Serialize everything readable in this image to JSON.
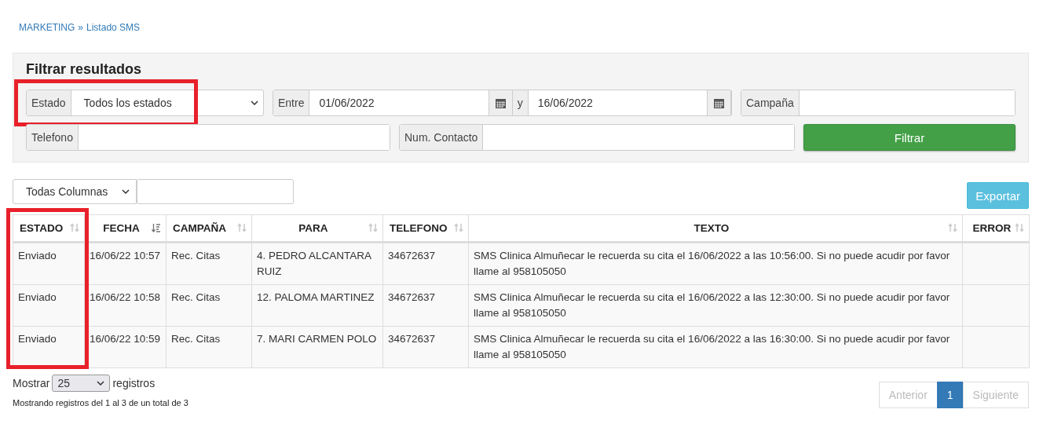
{
  "breadcrumb": {
    "items": [
      "MARKETING",
      "Listado SMS"
    ],
    "separator": "»"
  },
  "filters": {
    "title": "Filtrar resultados",
    "estado": {
      "label": "Estado",
      "value": "Todos los estados",
      "highlighted": true
    },
    "date_range": {
      "label": "Entre",
      "from": "01/06/2022",
      "joiner": "y",
      "to": "16/06/2022"
    },
    "campana": {
      "label": "Campaña"
    },
    "telefono": {
      "label": "Telefono"
    },
    "num_contacto": {
      "label": "Num. Contacto"
    },
    "button": "Filtrar"
  },
  "toolbar": {
    "column_select": "Todas Columnas",
    "export_button": "Exportar"
  },
  "table": {
    "columns": [
      {
        "label": "ESTADO",
        "sorted": false,
        "highlighted": true
      },
      {
        "label": "FECHA",
        "sorted": true,
        "highlighted": false
      },
      {
        "label": "CAMPAÑA",
        "sorted": false,
        "highlighted": false
      },
      {
        "label": "PARA",
        "sorted": false,
        "highlighted": false
      },
      {
        "label": "TELEFONO",
        "sorted": false,
        "highlighted": false
      },
      {
        "label": "TEXTO",
        "sorted": false,
        "highlighted": false
      },
      {
        "label": "ERROR",
        "sorted": false,
        "highlighted": false
      }
    ],
    "rows": [
      [
        "Enviado",
        "16/06/22 10:57",
        "Rec. Citas",
        "4. PEDRO ALCANTARA RUIZ",
        "34672637",
        "SMS Clinica Almuñecar le recuerda su cita el 16/06/2022 a las 10:56:00. Si no puede acudir por favor llame al 958105050"
      ],
      [
        "Enviado",
        "16/06/22 10:58",
        "Rec. Citas",
        "12. PALOMA MARTINEZ",
        "34672637",
        "SMS Clinica Almuñecar le recuerda su cita el 16/06/2022 a las 12:30:00. Si no puede acudir por favor llame al 958105050"
      ],
      [
        "Enviado",
        "16/06/22 10:59",
        "Rec. Citas",
        "7. MARI CARMEN POLO",
        "34672637",
        "SMS Clinica Almuñecar le recuerda su cita el 16/06/2022 a las 16:30:00. Si no puede acudir por favor llame al 958105050"
      ]
    ]
  },
  "footer": {
    "show_label": "Mostrar",
    "page_size": "25",
    "show_suffix": "registros",
    "summary": "Mostrando registros del 1 al 3 de un total de 3"
  },
  "pagination": [
    {
      "label": "Anterior",
      "selected": false,
      "disabled": true
    },
    {
      "label": "1",
      "selected": true,
      "disabled": false
    },
    {
      "label": "Siguiente",
      "selected": false,
      "disabled": true
    }
  ]
}
